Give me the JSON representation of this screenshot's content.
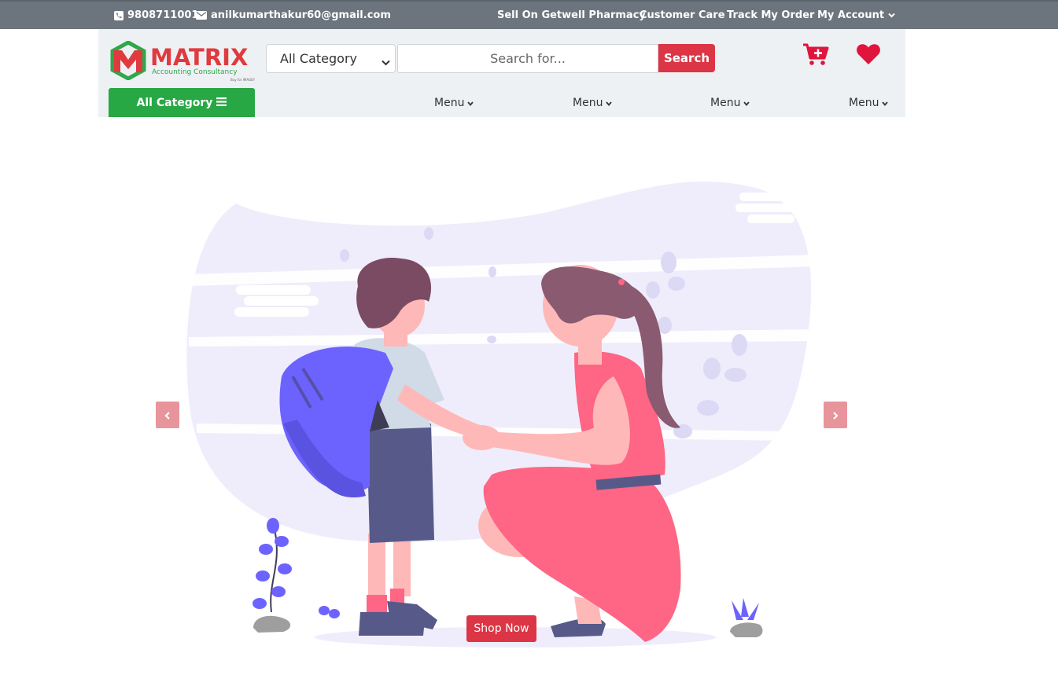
{
  "topbar": {
    "phone": "9808711001",
    "email": "anilkumarthakur60@gmail.com",
    "links": [
      "Sell On Getwell Pharmacy",
      "Customer Care",
      "Track My Order",
      "My Account"
    ]
  },
  "header": {
    "logo_text": "MATRIX",
    "logo_subtitle": "Accounting Consultancy",
    "logo_tagline": "Buy for IMAGEY",
    "category_select": "All Category",
    "search_placeholder": "Search for...",
    "search_button": "Search",
    "all_category_button": "All Category",
    "menus": [
      "Menu",
      "Menu",
      "Menu",
      "Menu"
    ]
  },
  "hero": {
    "shop_button": "Shop Now"
  },
  "colors": {
    "topbar": "#6c757d",
    "header_bg": "#eef1f4",
    "accent_red": "#dc3545",
    "green": "#28a745",
    "illustration_blob": "#efedfb",
    "backpack": "#6c63ff"
  },
  "icons": [
    "phone-icon",
    "envelope-icon",
    "chevron-down-icon",
    "cart-plus-icon",
    "heart-icon",
    "bars-icon",
    "chevron-left-icon",
    "chevron-right-icon"
  ]
}
